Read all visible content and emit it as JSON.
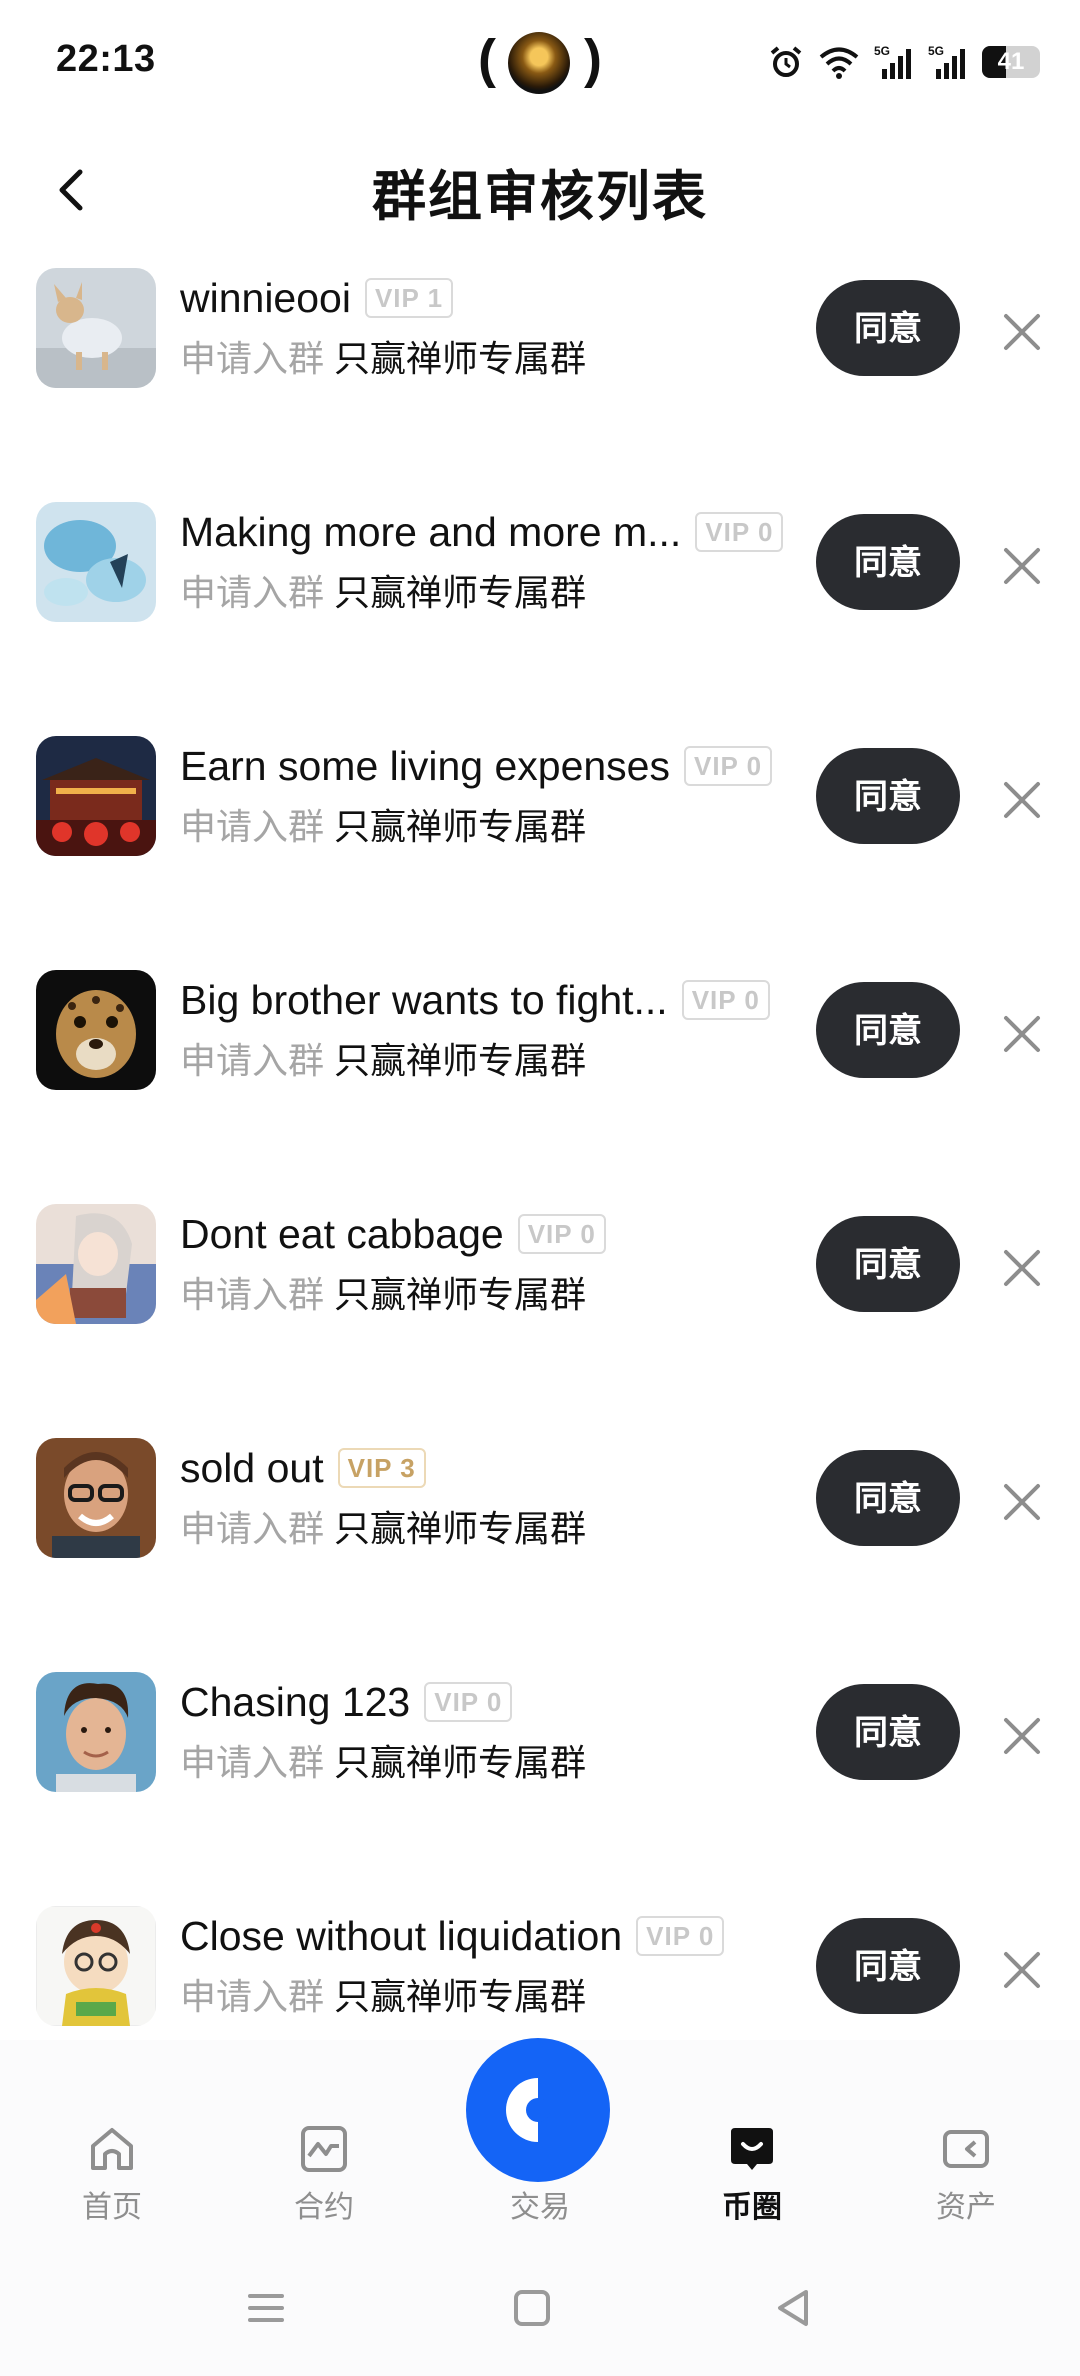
{
  "status_bar": {
    "time": "22:13",
    "battery_level": "41",
    "battery_fraction": 0.41,
    "network_labels": [
      "5G",
      "5G"
    ]
  },
  "header": {
    "title": "群组审核列表"
  },
  "requests": [
    {
      "name": "winnieooi",
      "vip": "VIP 1",
      "request_label": "申请入群",
      "group": "只赢禅师专属群",
      "agree_label": "同意"
    },
    {
      "name": "Making more and more m...",
      "vip": "VIP 0",
      "request_label": "申请入群",
      "group": "只赢禅师专属群",
      "agree_label": "同意"
    },
    {
      "name": "Earn some living expenses",
      "vip": "VIP 0",
      "request_label": "申请入群",
      "group": "只赢禅师专属群",
      "agree_label": "同意"
    },
    {
      "name": "Big brother wants to fight...",
      "vip": "VIP 0",
      "request_label": "申请入群",
      "group": "只赢禅师专属群",
      "agree_label": "同意"
    },
    {
      "name": "Dont eat cabbage",
      "vip": "VIP 0",
      "request_label": "申请入群",
      "group": "只赢禅师专属群",
      "agree_label": "同意"
    },
    {
      "name": "sold out",
      "vip": "VIP 3",
      "request_label": "申请入群",
      "group": "只赢禅师专属群",
      "agree_label": "同意"
    },
    {
      "name": "Chasing 123",
      "vip": "VIP 0",
      "request_label": "申请入群",
      "group": "只赢禅师专属群",
      "agree_label": "同意"
    },
    {
      "name": "Close without liquidation",
      "vip": "VIP 0",
      "request_label": "申请入群",
      "group": "只赢禅师专属群",
      "agree_label": "同意"
    }
  ],
  "bottom_nav": {
    "home": "首页",
    "contract": "合约",
    "trade": "交易",
    "coin_circle": "币圈",
    "assets": "资产",
    "active_tab": "币圈"
  },
  "colors": {
    "agree_button": "#2a2c30",
    "trade_button": "#1464f6",
    "vip_gold": "#c7a264",
    "muted_text": "#a5a5a5"
  }
}
